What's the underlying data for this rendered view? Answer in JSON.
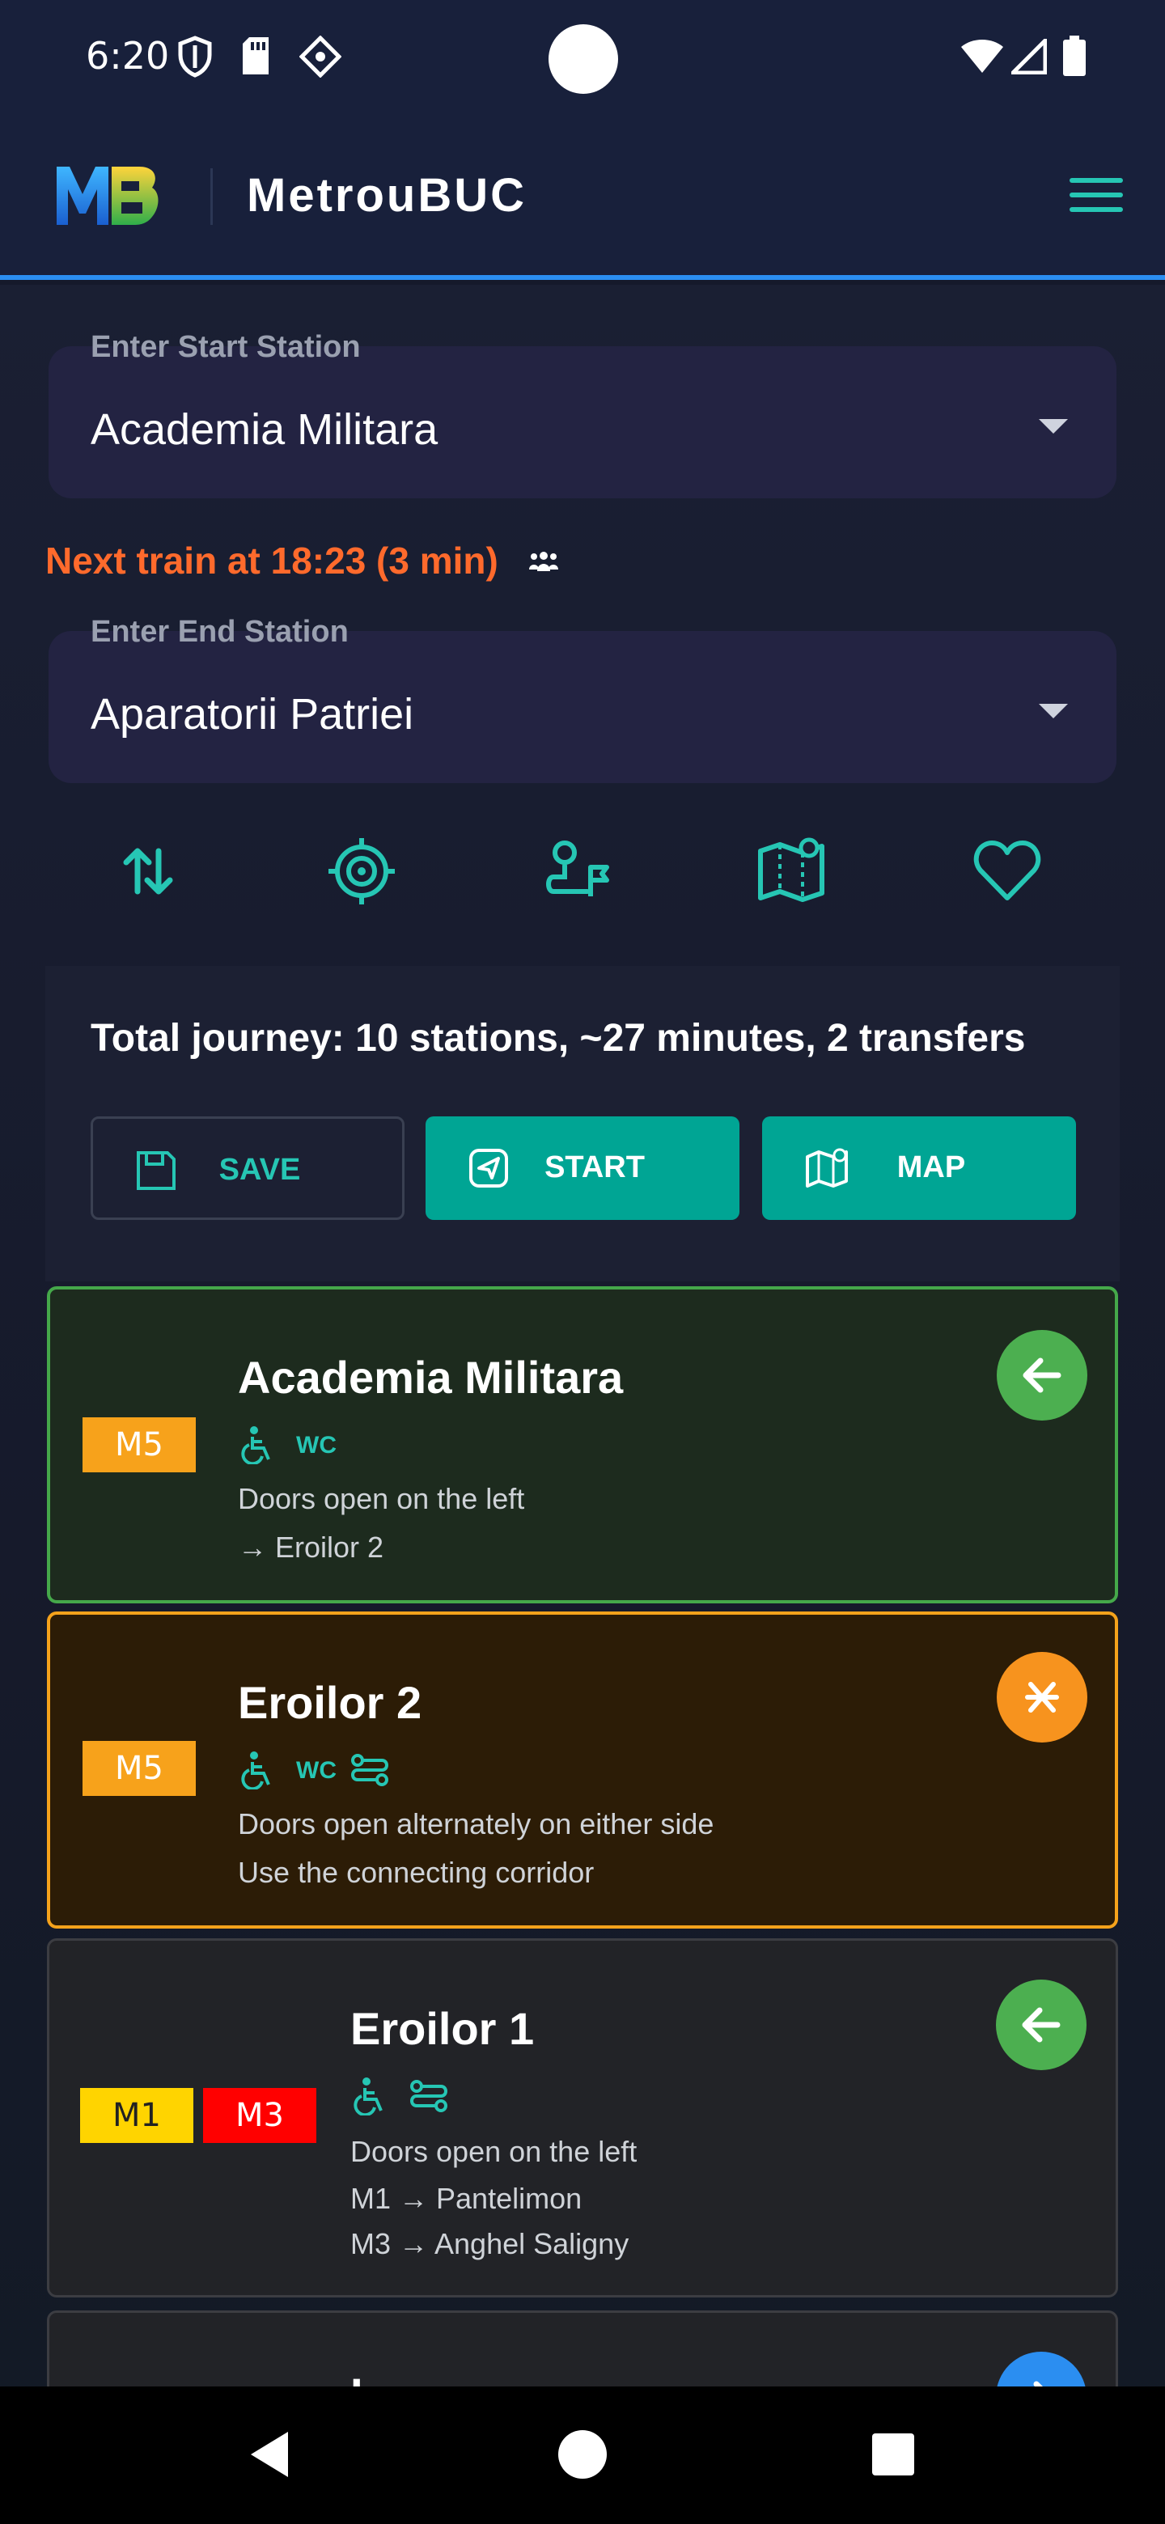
{
  "status_bar": {
    "time": "6:20"
  },
  "app": {
    "title": "MetrouBUC",
    "logo_text": "MB"
  },
  "start_station": {
    "label": "Enter Start Station",
    "value": "Academia Militara"
  },
  "next_train": {
    "text": "Next train at 18:23 (3 min)"
  },
  "end_station": {
    "label": "Enter End Station",
    "value": "Aparatorii Patriei"
  },
  "toolbar": {
    "icons": [
      "swap-icon",
      "locate-target-icon",
      "route-icon",
      "map-pin-icon",
      "favorite-heart-icon"
    ]
  },
  "summary": {
    "text": "Total journey: 10 stations, ~27 minutes, 2 transfers"
  },
  "actions": {
    "save": "SAVE",
    "start": "START",
    "map": "MAP"
  },
  "stations": [
    {
      "name": "Academia Militara",
      "lines": [
        "M5"
      ],
      "amenities": [
        "wheelchair",
        "WC"
      ],
      "doors": "Doors open on the left",
      "direction_1": "→ Eroilor 2"
    },
    {
      "name": "Eroilor 2",
      "lines": [
        "M5"
      ],
      "amenities": [
        "wheelchair",
        "WC",
        "transfer"
      ],
      "doors": "Doors open alternately on either side",
      "direction_1": "Use the connecting corridor"
    },
    {
      "name": "Eroilor 1",
      "lines": [
        "M1",
        "M3"
      ],
      "amenities": [
        "wheelchair",
        "transfer"
      ],
      "doors": "Doors open on the left",
      "direction_1": "M1 → Pantelimon",
      "direction_2": "M3 → Anghel Saligny"
    },
    {
      "name": "I..."
    }
  ],
  "colors": {
    "accent": "#00a594",
    "teal_icon": "#26c6b4",
    "line_m5": "#f7a21b",
    "line_m1": "#ffd400",
    "line_m3": "#ff0000",
    "alert": "#ff6a2c",
    "appbar_border": "#2b8ef1"
  },
  "wc_label": "WC"
}
